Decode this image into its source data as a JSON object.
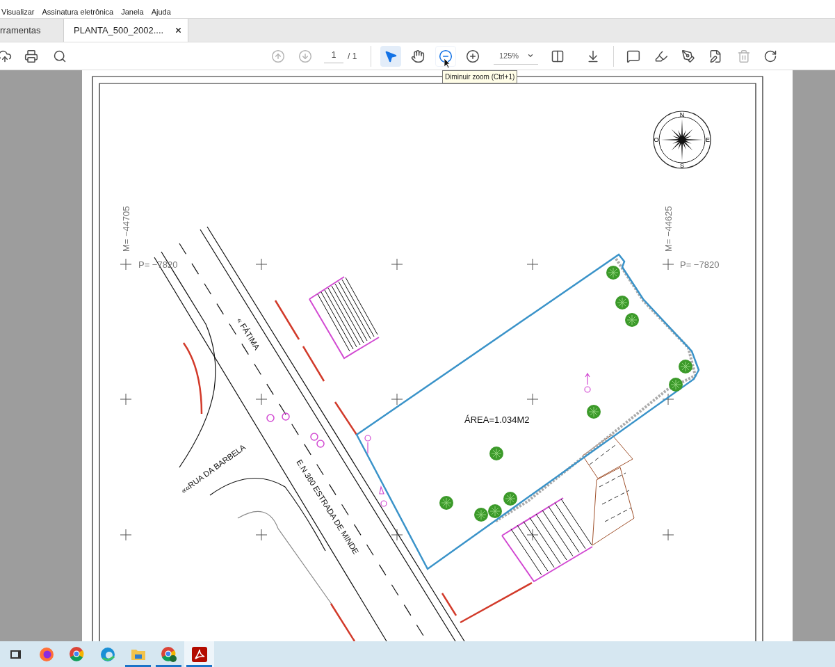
{
  "menu_bar": {
    "items": [
      "Visualizar",
      "Assinatura eletrônica",
      "Janela",
      "Ajuda"
    ]
  },
  "tabs": [
    {
      "label": "rramentas",
      "selected": false
    },
    {
      "label": "PLANTA_500_2002....",
      "selected": true
    }
  ],
  "toolbar": {
    "left_tools": [
      {
        "kind": "upload",
        "disabled": false
      },
      {
        "kind": "print",
        "disabled": false
      },
      {
        "kind": "find",
        "disabled": false
      }
    ],
    "navigation": {
      "tools": [
        {
          "kind": "previous_page",
          "disabled": true
        },
        {
          "kind": "next_page",
          "disabled": true
        }
      ],
      "page": "1",
      "total": "/ 1"
    },
    "view_tools": [
      {
        "kind": "select",
        "selected": true,
        "hovered": false
      },
      {
        "kind": "hand",
        "selected": false,
        "hovered": false
      },
      {
        "kind": "zoom_out",
        "selected": false,
        "hovered": true
      },
      {
        "kind": "zoom_in",
        "selected": false,
        "hovered": false
      }
    ],
    "zoom": {
      "value": "125%"
    },
    "layout_tools": [
      {
        "kind": "fit_page",
        "disabled": false
      },
      {
        "kind": "scroll_mode",
        "disabled": false
      }
    ],
    "edit_tools": [
      {
        "kind": "comment",
        "disabled": false
      },
      {
        "kind": "highlight",
        "disabled": false
      },
      {
        "kind": "sign",
        "disabled": false
      },
      {
        "kind": "edit",
        "disabled": false
      },
      {
        "kind": "delete",
        "disabled": true
      },
      {
        "kind": "rotate",
        "disabled": false
      }
    ]
  },
  "tooltip": {
    "text": "Diminuir zoom (Ctrl+1)"
  },
  "drawing": {
    "labels": [
      {
        "kind": "coordinate",
        "text": "M= −44705"
      },
      {
        "kind": "coordinate",
        "text": "P= −7820"
      },
      {
        "kind": "coordinate",
        "text": "M= −44625"
      },
      {
        "kind": "coordinate",
        "text": "P= −7820"
      },
      {
        "kind": "street",
        "text": "« FÁTIMA"
      },
      {
        "kind": "street",
        "text": "««RUA DA BARBELA"
      },
      {
        "kind": "street",
        "text": "E.N.360 ESTRADA DE MINDE"
      },
      {
        "kind": "area",
        "text": "ÁREA=1.034M2"
      }
    ],
    "compass": {
      "north": "N",
      "east": "E",
      "south": "S",
      "west": "O"
    }
  },
  "taskbar": {
    "items": [
      {
        "kind": "task_view",
        "running": false,
        "selected": false
      },
      {
        "kind": "firefox",
        "running": false,
        "selected": false
      },
      {
        "kind": "chrome",
        "running": false,
        "selected": false
      },
      {
        "kind": "edge",
        "running": false,
        "selected": false
      },
      {
        "kind": "explorer",
        "running": true,
        "selected": false
      },
      {
        "kind": "chrome_profile",
        "running": true,
        "selected": false
      },
      {
        "kind": "acrobat",
        "running": true,
        "selected": true
      }
    ]
  }
}
